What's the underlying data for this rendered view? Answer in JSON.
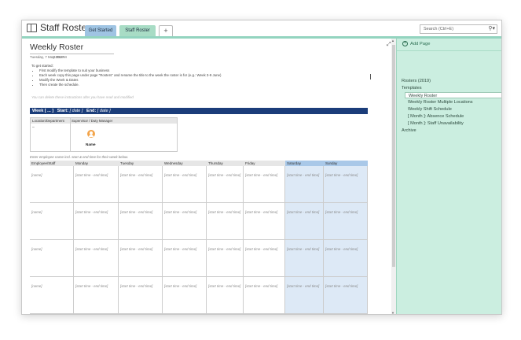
{
  "header": {
    "notebook_title": "Staff Roster",
    "tabs": [
      "Get Started",
      "Staff Roster"
    ],
    "add_tab": "+",
    "search_placeholder": "Search (Ctrl+E)"
  },
  "page": {
    "title": "Weekly Roster",
    "date": "Tuesday, 7 May 2019",
    "time": "5:08 PM",
    "instructions_heading": "To get started:",
    "instructions": [
      "First modify the template to suit your business",
      "Each week copy this page under page \"Rosters\" and rename the title to the week the roster is for (e.g.: Week 3-9 June)",
      "Modify the Week & Dates",
      "Then create the schedule."
    ],
    "instructions_note": "You can delete these instructions after you have read and modified",
    "week_bar": {
      "week": "Week [ ... ]",
      "start_label": "Start:",
      "start_value": "[ date ]",
      "end_label": "End:",
      "end_value": "[ date ]"
    },
    "supervisor_table": {
      "headers": [
        "Location/Department",
        "Supervisor / Duty Manager"
      ],
      "location_value": "–",
      "supervisor_name": "Name"
    },
    "schedule_note": "Enter employee name incl. start & end time for their week below.",
    "schedule": {
      "headers": [
        "Employee/Staff",
        "Monday",
        "Tuesday",
        "Wednesday",
        "Thursday",
        "Friday",
        "Saturday",
        "Sunday"
      ],
      "name_placeholder": "[name]",
      "time_placeholder": "[start time - end time]",
      "row_count": 4
    }
  },
  "sidebar": {
    "add_page": "Add Page",
    "items": [
      {
        "label": "Rosters (2019)",
        "level": 0,
        "selected": false
      },
      {
        "label": "Templates",
        "level": 0,
        "selected": false
      },
      {
        "label": "Weekly Roster",
        "level": 1,
        "selected": true
      },
      {
        "label": "Weekly Roster Multiple Locations",
        "level": 1,
        "selected": false
      },
      {
        "label": "Weekly Shift Schedule",
        "level": 1,
        "selected": false
      },
      {
        "label": "[ Month ]: Absence Schedule",
        "level": 1,
        "selected": false
      },
      {
        "label": "[ Month ]: Staff Unavailability",
        "level": 1,
        "selected": false
      },
      {
        "label": "Archive",
        "level": 0,
        "selected": false
      }
    ]
  },
  "icons": {
    "notebook": "notebook-icon",
    "dropdown": "chevron-down-icon",
    "search": "search-icon",
    "expand": "expand-icon",
    "add_page": "plus-circle-icon",
    "avatar": "person-icon"
  },
  "colors": {
    "accent_teal": "#93d4bf",
    "pane_background": "#cbeee0",
    "week_bar": "#1b3d7a",
    "weekend_header": "#a9c8e8",
    "weekend_cell": "#dde9f6"
  }
}
